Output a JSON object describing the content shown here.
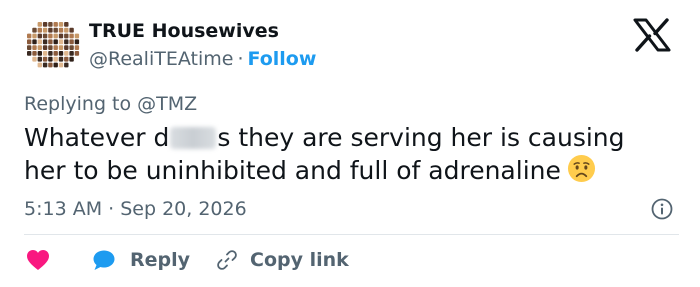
{
  "user": {
    "display_name": "TRUE Housewives",
    "handle": "@RealiTEAtime",
    "separator": "·",
    "follow_label": "Follow"
  },
  "tweet": {
    "reply_label": "Replying to @TMZ",
    "text_before_blur": "Whatever d",
    "text_after_blur": "s they are serving her is causing her to be uninhibited and full of adrenaline",
    "emoji": "worried-face-icon",
    "timestamp": "5:13 AM · Sep 20, 2026"
  },
  "actions": {
    "like_icon": "heart-icon",
    "reply_label": "Reply",
    "copy_label": "Copy link"
  },
  "colors": {
    "accent": "#1d9bf0",
    "like": "#f91880",
    "muted_text": "#536471",
    "primary_text": "#0f1419"
  }
}
